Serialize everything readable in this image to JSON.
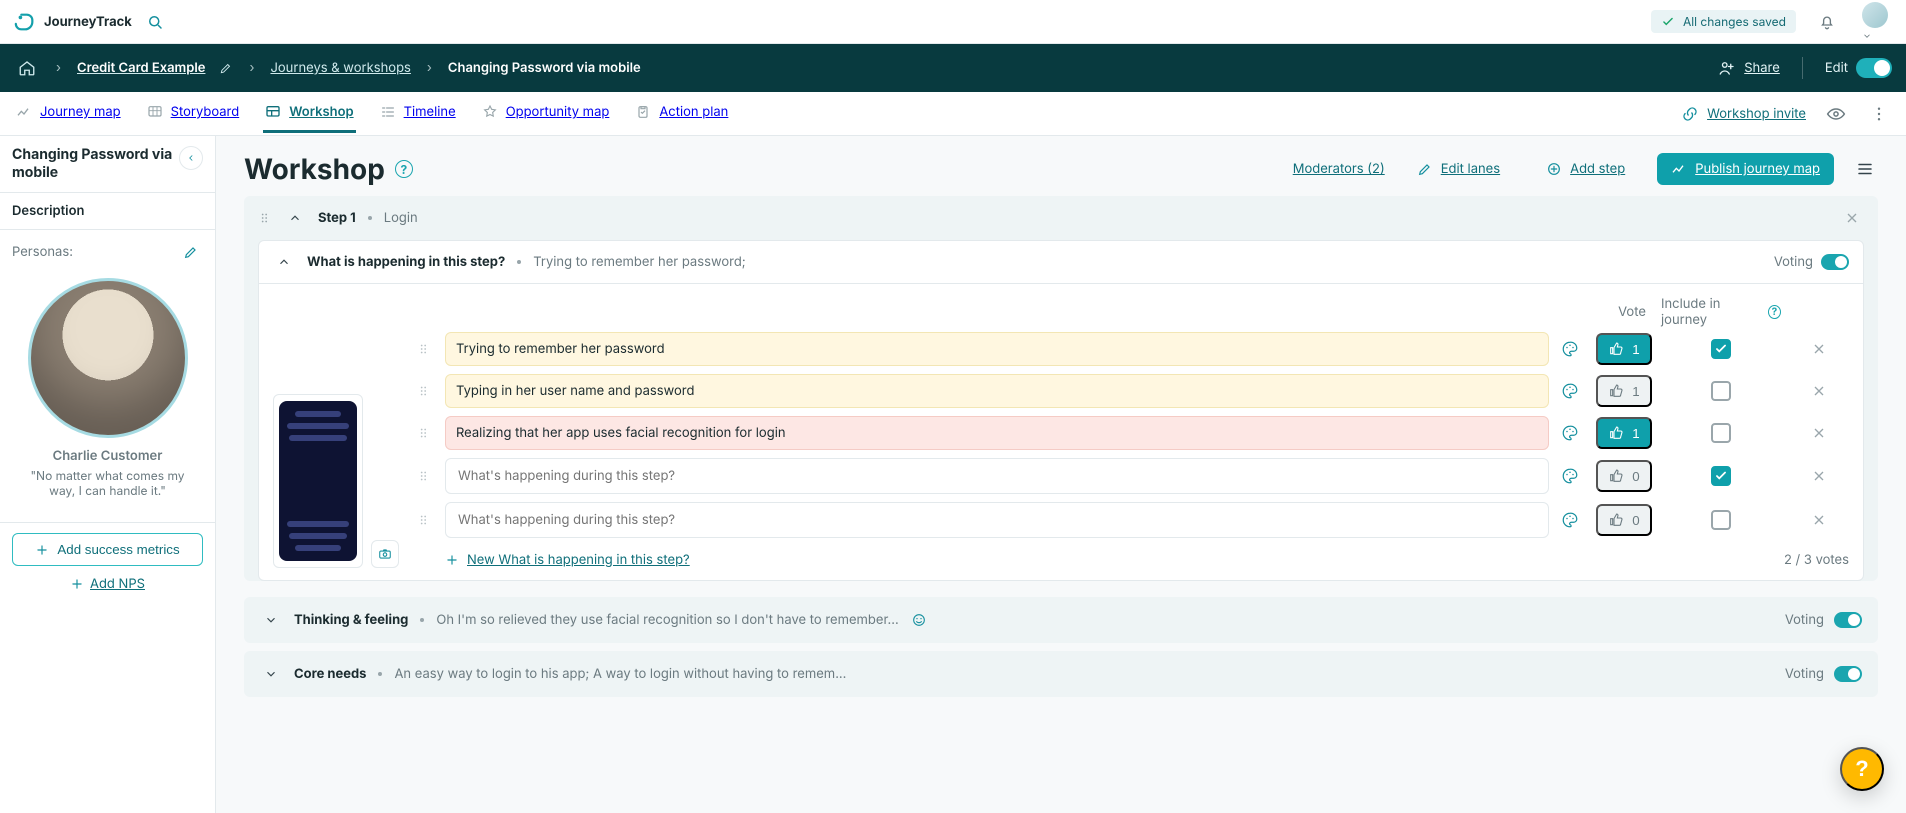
{
  "brand": {
    "name": "JourneyTrack"
  },
  "saved_label": "All changes saved",
  "breadcrumbs": {
    "project": "Credit Card Example",
    "section": "Journeys & workshops",
    "page": "Changing Password via mobile"
  },
  "nav": {
    "share": "Share",
    "edit": "Edit"
  },
  "tabs": {
    "journey_map": "Journey map",
    "storyboard": "Storyboard",
    "workshop": "Workshop",
    "timeline": "Timeline",
    "opportunity_map": "Opportunity map",
    "action_plan": "Action plan"
  },
  "right_tools": {
    "workshop_invite": "Workshop invite"
  },
  "sidebar": {
    "title": "Changing Password via mobile",
    "description_label": "Description",
    "personas_label": "Personas:",
    "persona": {
      "name": "Charlie Customer",
      "quote": "\"No matter what comes my way, I can handle it.\""
    },
    "add_metrics": "Add success metrics",
    "add_nps": "Add NPS"
  },
  "content": {
    "title": "Workshop",
    "moderators": "Moderators (2)",
    "edit_lanes": "Edit lanes",
    "add_step": "Add step",
    "publish": "Publish journey map"
  },
  "step": {
    "label": "Step 1",
    "name": "Login",
    "card_title": "What is happening in this step?",
    "card_sub": "Trying to remember her password;",
    "voting_label": "Voting",
    "columns": {
      "vote": "Vote",
      "include": "Include in journey"
    },
    "rows": [
      {
        "text": "Trying to remember her password",
        "style": "yellow",
        "votes": 1,
        "voted": true,
        "included": true
      },
      {
        "text": "Typing in her user name and password",
        "style": "yellow",
        "votes": 1,
        "voted": false,
        "included": false
      },
      {
        "text": "Realizing that her app uses facial recognition for login",
        "style": "pink",
        "votes": 1,
        "voted": true,
        "included": false
      },
      {
        "text": "",
        "style": "",
        "votes": 0,
        "voted": false,
        "included": true,
        "placeholder": "What's happening during this step?"
      },
      {
        "text": "",
        "style": "",
        "votes": 0,
        "voted": false,
        "included": false,
        "placeholder": "What's happening during this step?"
      }
    ],
    "add_row": "New What is happening in this step?",
    "votes_summary": "2 / 3 votes"
  },
  "lanes": [
    {
      "title": "Thinking & feeling",
      "preview": "Oh I'm so relieved they use facial recognition so I don't have to remember...",
      "voting": "Voting"
    },
    {
      "title": "Core needs",
      "preview": "An easy way to login to his app; A way to login without having to remem...",
      "voting": "Voting"
    }
  ]
}
